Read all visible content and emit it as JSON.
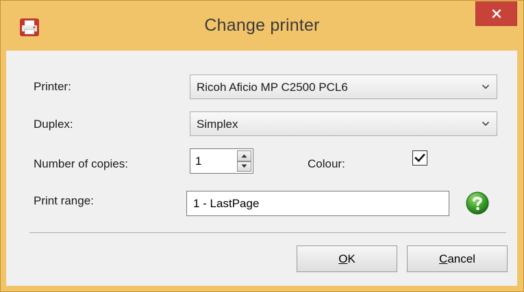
{
  "window": {
    "title": "Change printer",
    "app_icon": "printer-app-icon",
    "close_icon": "close-icon"
  },
  "colors": {
    "frame": "#f2c46a",
    "close": "#c7433a",
    "client": "#f0f0f0",
    "help": "#3aa12a"
  },
  "form": {
    "printer": {
      "label": "Printer:",
      "value": "Ricoh Aficio MP C2500 PCL6"
    },
    "duplex": {
      "label": "Duplex:",
      "value": "Simplex"
    },
    "copies": {
      "label": "Number of copies:",
      "value": "1"
    },
    "colour": {
      "label": "Colour:",
      "checked": true
    },
    "range": {
      "label": "Print range:",
      "value": "1 - LastPage"
    },
    "help_icon": "help-question-icon"
  },
  "buttons": {
    "ok": {
      "mnemonic": "O",
      "rest": "K"
    },
    "cancel": {
      "mnemonic": "C",
      "rest": "ancel"
    }
  }
}
